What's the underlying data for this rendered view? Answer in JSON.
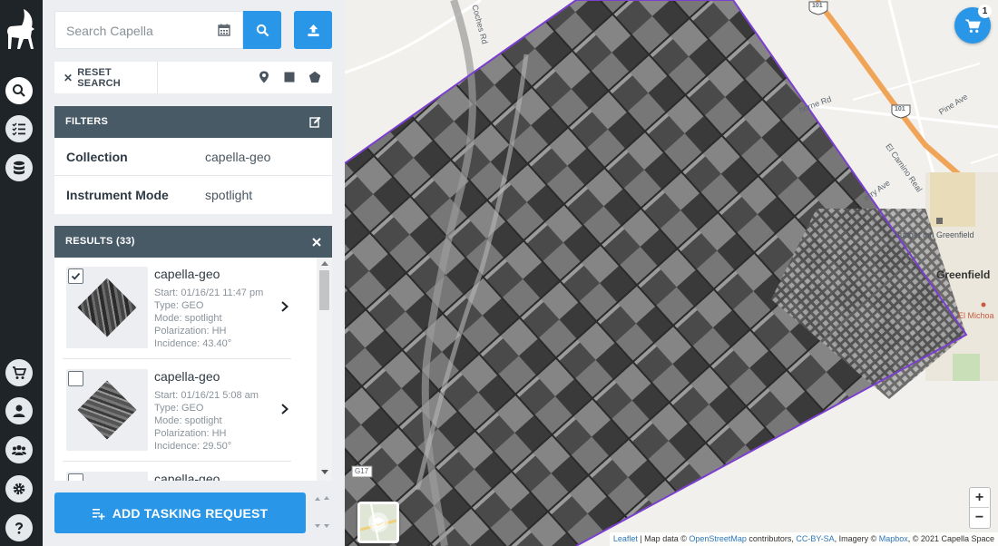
{
  "search": {
    "placeholder": "Search Capella"
  },
  "toolbar": {
    "reset_label": "RESET SEARCH"
  },
  "filters": {
    "header": "FILTERS",
    "rows": [
      {
        "key": "Collection",
        "value": "capella-geo"
      },
      {
        "key": "Instrument Mode",
        "value": "spotlight"
      }
    ]
  },
  "results": {
    "header": "RESULTS (33)",
    "items": [
      {
        "title": "capella-geo",
        "start": "Start: 01/16/21 11:47 pm",
        "type": "Type: GEO",
        "mode": "Mode: spotlight",
        "polarization": "Polarization: HH",
        "incidence": "Incidence: 43.40°",
        "checked": true
      },
      {
        "title": "capella-geo",
        "start": "Start: 01/16/21 5:08 am",
        "type": "Type: GEO",
        "mode": "Mode: spotlight",
        "polarization": "Polarization: HH",
        "incidence": "Incidence: 29.50°",
        "checked": false
      },
      {
        "title": "capella-geo",
        "start": "",
        "type": "",
        "mode": "",
        "polarization": "",
        "incidence": "",
        "checked": false
      }
    ]
  },
  "actions": {
    "tasking_label": "ADD TASKING REQUEST"
  },
  "cart": {
    "count": "1"
  },
  "map": {
    "roads": {
      "coches": "Coches Rd",
      "thorne": "horne Rd",
      "pine": "Pine Ave",
      "elcamino": "El Camino Real",
      "cherry": "erry Ave",
      "hwy101a": "101",
      "hwy101b": "101",
      "g17": "G17"
    },
    "town": "Greenfield",
    "pois": {
      "budget": "Budget Inn Greenfield",
      "michoa": "El Michoa"
    },
    "zoom_in": "+",
    "zoom_out": "−",
    "attribution": {
      "leaflet": "Leaflet",
      "sep1": " | Map data © ",
      "osm": "OpenStreetMap",
      "sep2": " contributors, ",
      "ccbysa": "CC-BY-SA",
      "sep3": ", Imagery © ",
      "mapbox": "Mapbox",
      "sep4": ", © 2021 Capella Space"
    }
  },
  "colors": {
    "accent": "#2a96e8",
    "rail": "#1f2428",
    "header": "#495a67",
    "footprint": "#7b3fd0"
  }
}
